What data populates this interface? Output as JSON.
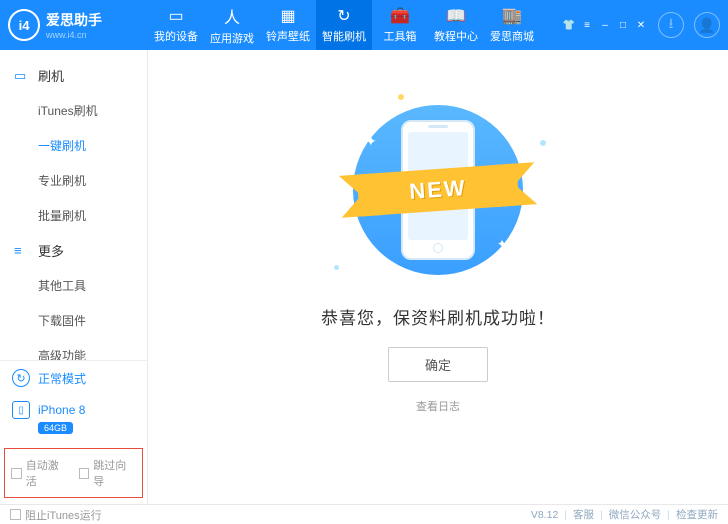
{
  "header": {
    "logo_text": "爱思助手",
    "logo_sub": "www.i4.cn",
    "logo_badge": "i4",
    "tabs": [
      {
        "label": "我的设备",
        "icon": "▭"
      },
      {
        "label": "应用游戏",
        "icon": "人"
      },
      {
        "label": "铃声壁纸",
        "icon": "▦"
      },
      {
        "label": "智能刷机",
        "icon": "↻"
      },
      {
        "label": "工具箱",
        "icon": "🧰"
      },
      {
        "label": "教程中心",
        "icon": "📖"
      },
      {
        "label": "爱思商城",
        "icon": "🏬"
      }
    ],
    "active_tab_index": 3
  },
  "sidebar": {
    "groups": [
      {
        "icon": "▭",
        "label": "刷机",
        "items": [
          "iTunes刷机",
          "一键刷机",
          "专业刷机",
          "批量刷机"
        ],
        "active_index": 1
      },
      {
        "icon": "≡",
        "label": "更多",
        "items": [
          "其他工具",
          "下载固件",
          "高级功能"
        ],
        "active_index": -1
      }
    ],
    "mode": {
      "label": "正常模式",
      "icon": "↻"
    },
    "device": {
      "name": "iPhone 8",
      "storage": "64GB"
    },
    "checkboxes": [
      "自动激活",
      "跳过向导"
    ]
  },
  "main": {
    "ribbon": "NEW",
    "success": "恭喜您，保资料刷机成功啦！",
    "confirm": "确定",
    "log_link": "查看日志"
  },
  "statusbar": {
    "block_itunes": "阻止iTunes运行",
    "version": "V8.12",
    "links": [
      "客服",
      "微信公众号",
      "检查更新"
    ]
  }
}
